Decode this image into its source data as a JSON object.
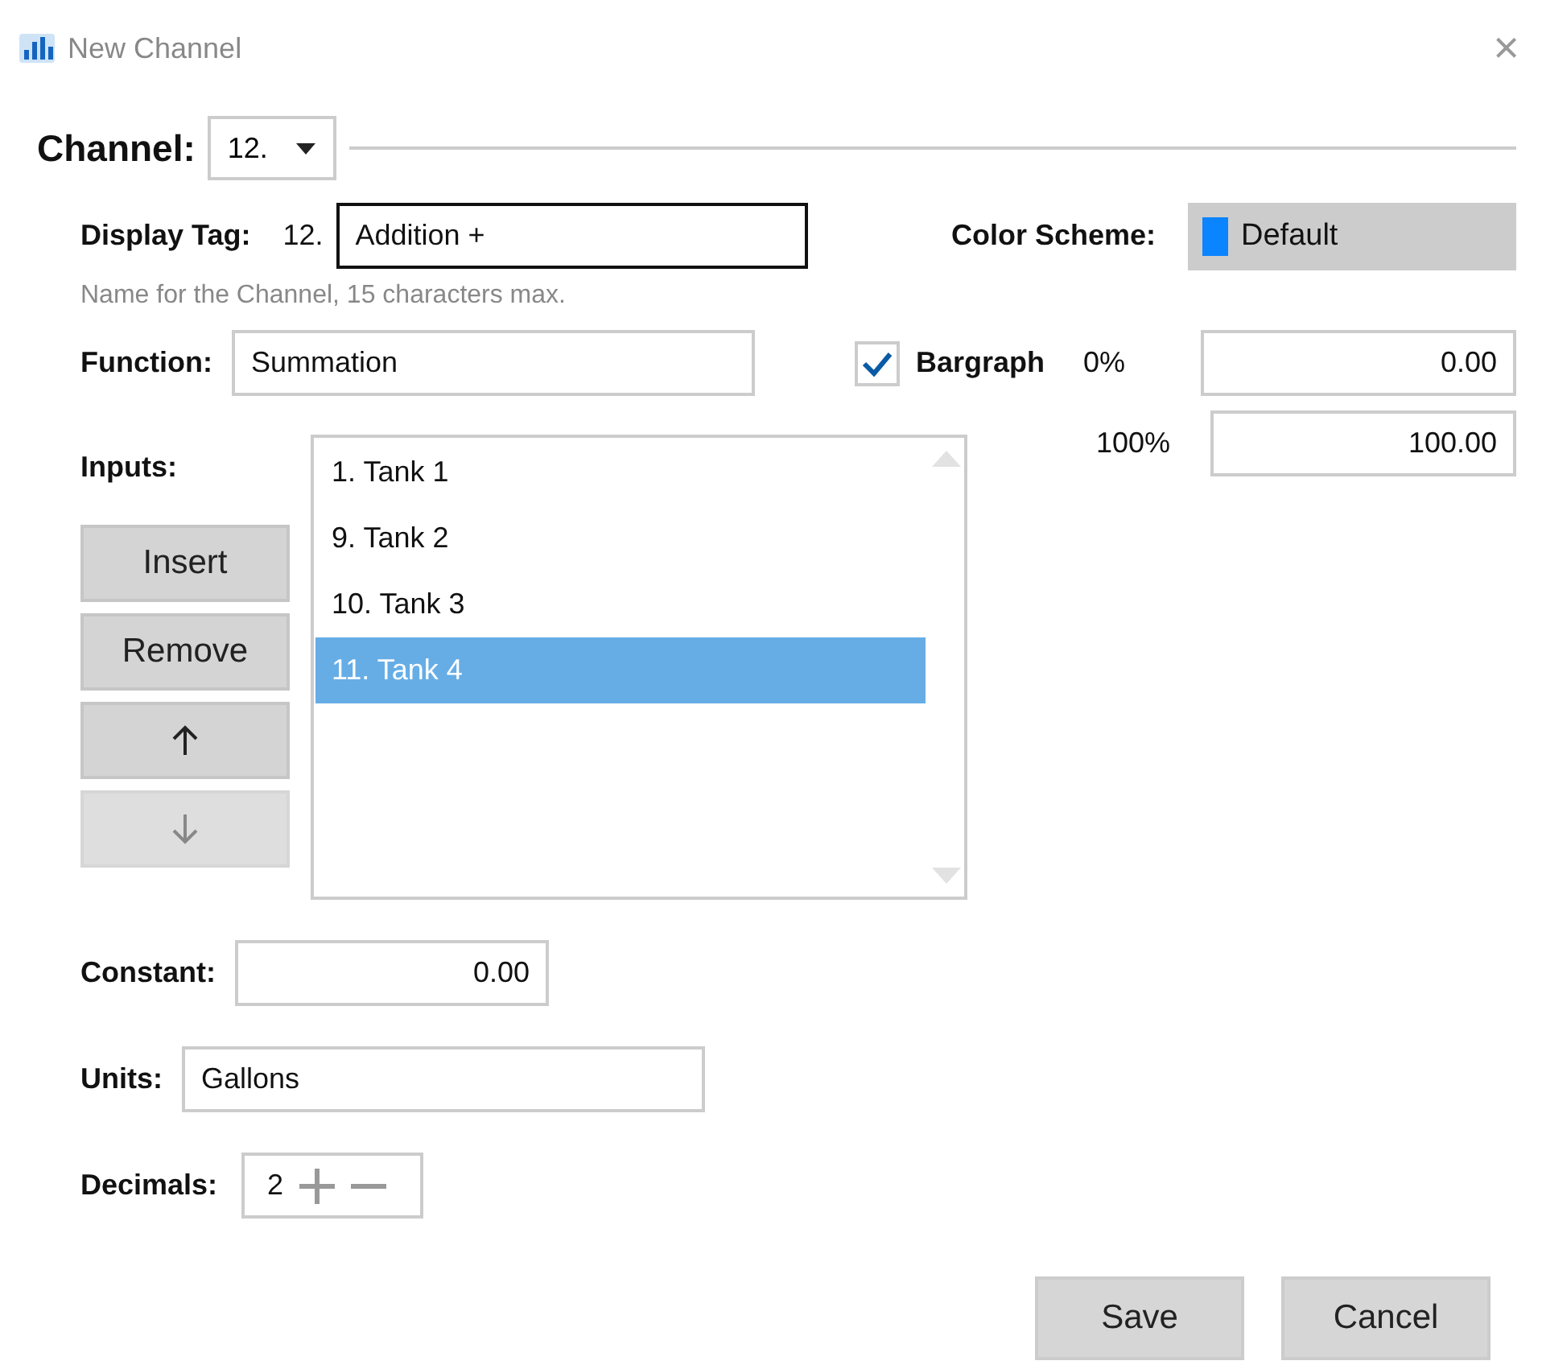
{
  "window": {
    "title": "New Channel",
    "close": "×"
  },
  "channel": {
    "label": "Channel:",
    "value": "12."
  },
  "display_tag": {
    "label": "Display Tag:",
    "prefix": "12.",
    "value": "Addition +",
    "hint": "Name for the Channel, 15 characters max."
  },
  "color_scheme": {
    "label": "Color Scheme:",
    "value": "Default",
    "color": "#0a84ff"
  },
  "function": {
    "label": "Function:",
    "value": "Summation"
  },
  "bargraph": {
    "label": "Bargraph",
    "checked": true,
    "min_label": "0%",
    "min_value": "0.00",
    "max_label": "100%",
    "max_value": "100.00"
  },
  "inputs": {
    "label": "Inputs:",
    "buttons": [
      {
        "kind": "text",
        "label": "Insert",
        "disabled": false
      },
      {
        "kind": "text",
        "label": "Remove",
        "disabled": false
      },
      {
        "kind": "up",
        "disabled": false
      },
      {
        "kind": "down",
        "disabled": true
      }
    ],
    "items": [
      {
        "label": "1. Tank 1",
        "selected": false
      },
      {
        "label": "9. Tank 2",
        "selected": false
      },
      {
        "label": "10. Tank 3",
        "selected": false
      },
      {
        "label": "11. Tank 4",
        "selected": true
      }
    ]
  },
  "constant": {
    "label": "Constant:",
    "value": "0.00"
  },
  "units": {
    "label": "Units:",
    "value": "Gallons"
  },
  "decimals": {
    "label": "Decimals:",
    "value": "2"
  },
  "buttons": [
    "Save",
    "Cancel"
  ]
}
